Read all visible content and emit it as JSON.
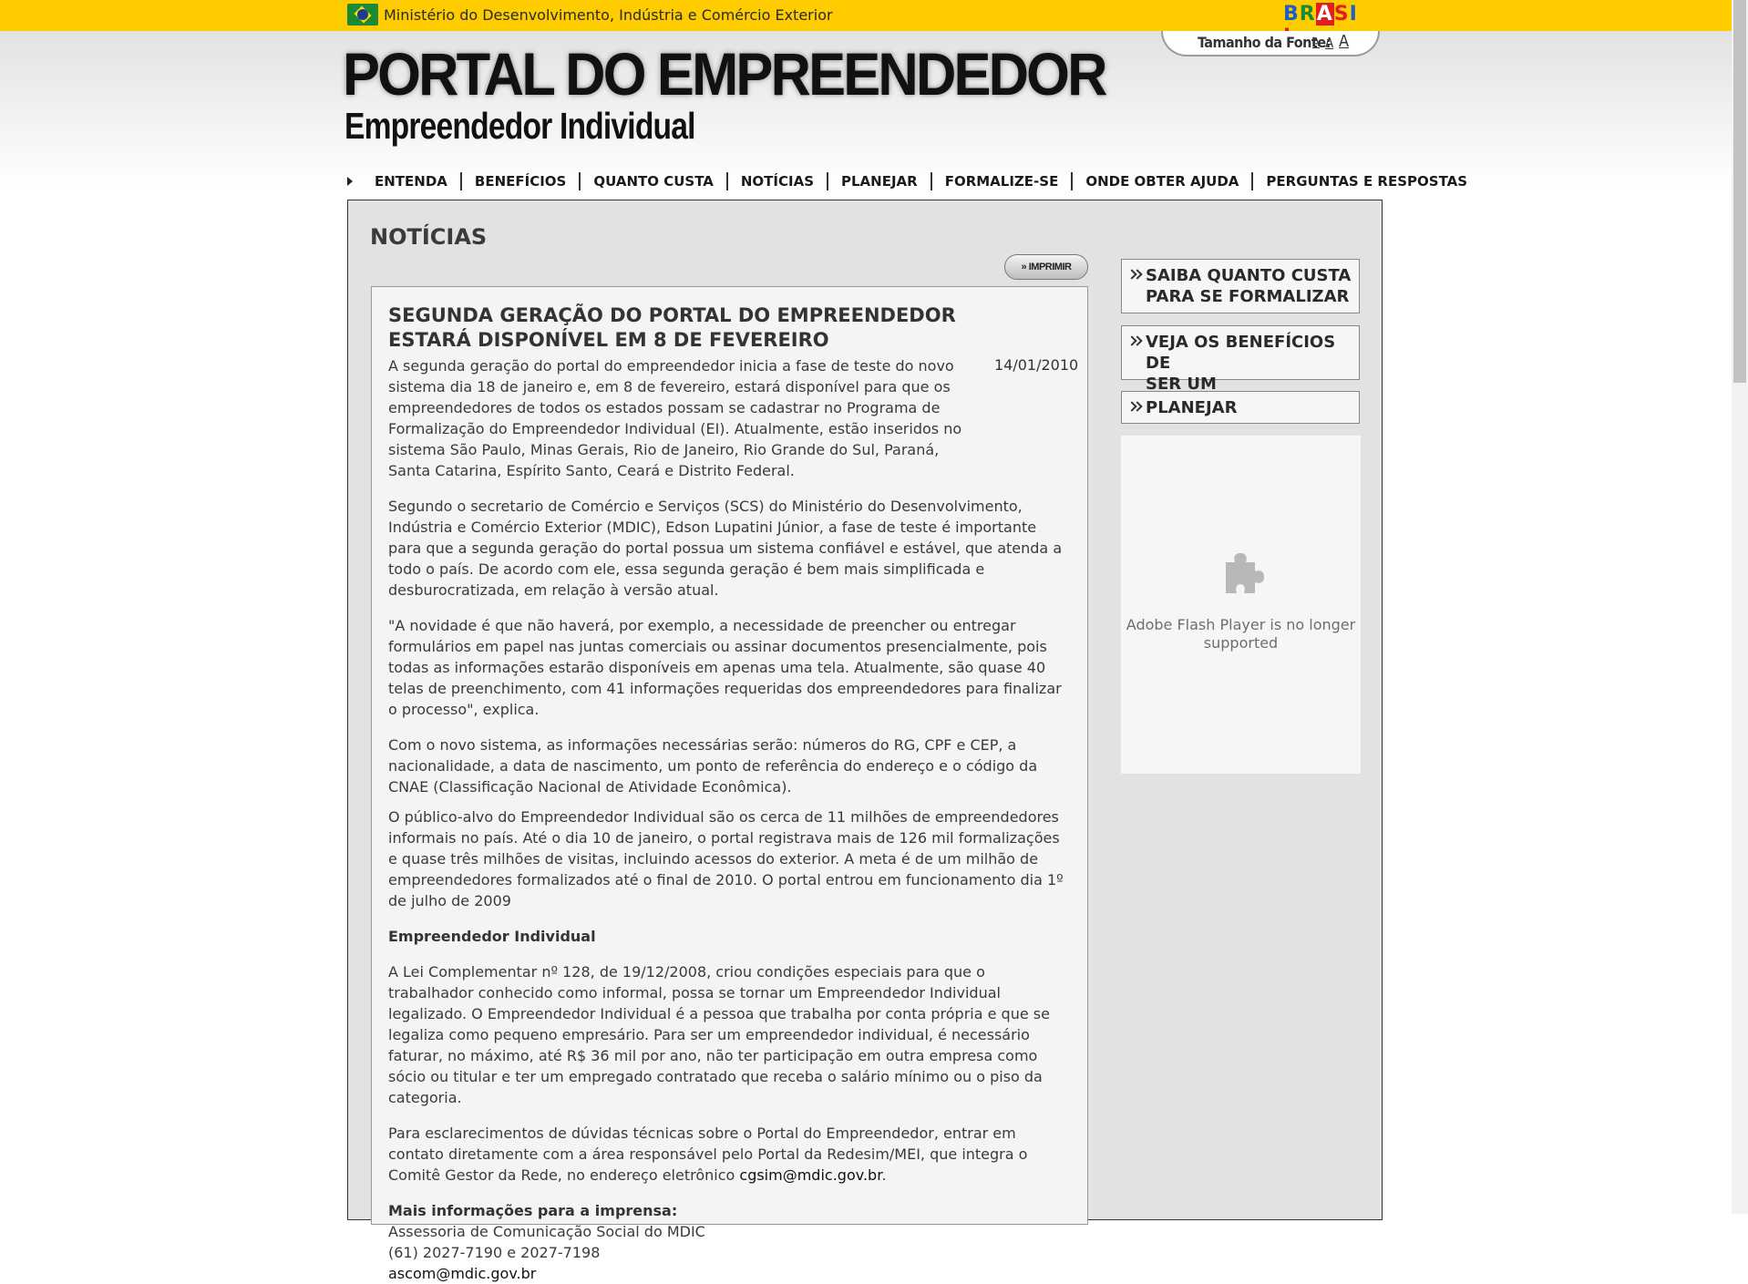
{
  "govbar": {
    "ministry": "Ministério do Desenvolvimento, Indústria e Comércio Exterior",
    "brasil_logo": "BRASIL"
  },
  "header": {
    "font_size_label": "Tamanho da Fonte:",
    "font_options": [
      "A",
      "A",
      "A"
    ],
    "logo_title": "PORTAL DO EMPREENDEDOR",
    "logo_subtitle": "Empreendedor Individual"
  },
  "nav": {
    "items": [
      "ENTENDA",
      "BENEFÍCIOS",
      "QUANTO CUSTA",
      "NOTÍCIAS",
      "PLANEJAR",
      "FORMALIZE-SE",
      "ONDE OBTER AJUDA",
      "PERGUNTAS E RESPOSTAS"
    ]
  },
  "main": {
    "page_title": "NOTÍCIAS",
    "print_label": "» IMPRIMIR"
  },
  "article": {
    "title": "SEGUNDA GERAÇÃO DO PORTAL DO EMPREENDEDOR ESTARÁ DISPONÍVEL EM 8 DE FEVEREIRO",
    "date": "14/01/2010",
    "p1": "A segunda geração do portal do empreendedor inicia a fase de teste do novo sistema dia 18 de janeiro e, em 8 de fevereiro, estará disponível para que os empreendedores de todos os estados possam se cadastrar no Programa de Formalização do Empreendedor Individual (EI). Atualmente, estão inseridos no sistema São Paulo, Minas Gerais, Rio de Janeiro, Rio Grande do Sul, Paraná, Santa Catarina, Espírito Santo, Ceará e Distrito Federal.",
    "p2": "Segundo o secretario de Comércio e Serviços (SCS) do Ministério do Desenvolvimento, Indústria e Comércio Exterior (MDIC), Edson Lupatini Júnior, a fase de teste é importante para que a segunda geração do portal possua um sistema confiável e estável, que atenda a todo o país. De acordo com ele, essa segunda geração é bem mais simplificada e desburocratizada, em relação à versão atual.",
    "p3": "\"A novidade é que não haverá, por exemplo, a necessidade de preencher ou entregar formulários em papel nas juntas comerciais ou assinar documentos presencialmente, pois todas as informações estarão disponíveis em apenas uma tela. Atualmente, são quase 40 telas de preenchimento, com 41 informações requeridas dos empreendedores para finalizar o processo\", explica.",
    "p4": "Com o novo sistema, as informações necessárias serão: números do RG, CPF e CEP, a nacionalidade, a data de nascimento, um ponto de referência do endereço e o código da CNAE (Classificação Nacional de Atividade Econômica).",
    "p5": "O público-alvo do Empreendedor Individual são os cerca de 11 milhões de empreendedores informais no país. Até o dia 10 de janeiro, o portal registrava mais de 126 mil formalizações e quase três milhões de visitas, incluindo acessos do exterior. A meta é de um milhão de empreendedores formalizados até o final de 2010. O portal entrou em funcionamento dia 1º de julho de 2009",
    "subheading": "Empreendedor Individual",
    "p6": "A Lei Complementar nº 128, de 19/12/2008, criou condições especiais para que o trabalhador conhecido como informal, possa se tornar um Empreendedor Individual legalizado. O Empreendedor Individual é a pessoa que trabalha por conta própria e que se legaliza como pequeno empresário. Para ser um empreendedor individual, é necessário faturar, no máximo, até R$ 36 mil por ano, não ter participação em outra empresa como sócio ou titular e ter um empregado contratado que receba o salário mínimo ou o piso da categoria.",
    "p7_text": "Para esclarecimentos de dúvidas técnicas sobre o Portal do Empreendedor, entrar em contato diretamente com a área responsável pelo Portal da Redesim/MEI, que integra o Comitê Gestor da Rede, no endereço eletrônico ",
    "p7_email": "cgsim@mdic.gov.br",
    "p7_end": ".",
    "press_heading": "Mais informações para a imprensa:",
    "press_line1": "Assessoria de Comunicação Social do MDIC",
    "press_line2": "(61) 2027-7190 e 2027-7198",
    "press_email": "ascom@mdic.gov.br"
  },
  "sidebar": {
    "box1_line1": "SAIBA QUANTO CUSTA",
    "box1_line2": "PARA SE FORMALIZAR",
    "box2_line1": "VEJA OS BENEFÍCIOS DE",
    "box2_line2": "SER UM EMPREENDEDOR",
    "box3_line1": "PLANEJAR",
    "flash_message": "Adobe Flash Player is no longer supported",
    "flash_icon": "puzzle-icon"
  }
}
